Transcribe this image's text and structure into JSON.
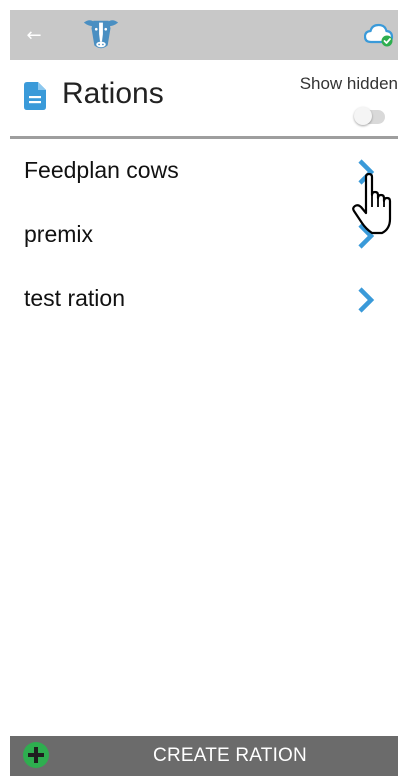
{
  "topbar": {
    "back_icon": "arrow-left-icon",
    "logo_icon": "cow-head-icon",
    "sync_icon": "cloud-check-icon",
    "background": "#c8c8c8"
  },
  "header": {
    "title": "Rations",
    "title_icon": "document-icon",
    "show_hidden_label": "Show hidden",
    "show_hidden_on": false
  },
  "rations": [
    {
      "label": "Feedplan cows"
    },
    {
      "label": "premix"
    },
    {
      "label": "test ration"
    }
  ],
  "footer": {
    "create_label": "CREATE RATION",
    "add_icon": "plus-circle-icon",
    "background": "#6b6b6b"
  },
  "colors": {
    "accent": "#3a9ad9",
    "logo": "#4a8fc2",
    "add_green": "#2eae4f"
  }
}
